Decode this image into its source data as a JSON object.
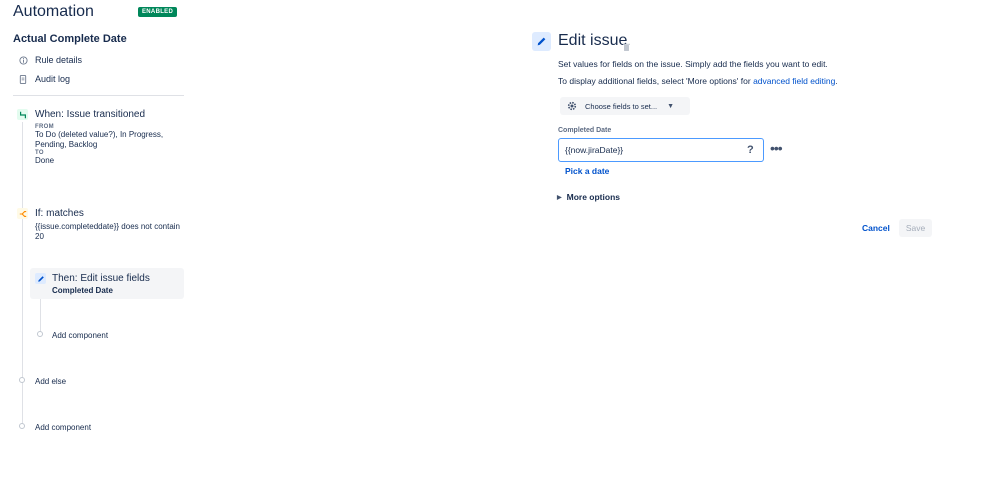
{
  "app": {
    "title": "Automation",
    "status_badge": "ENABLED",
    "rule_name": "Actual Complete Date"
  },
  "nav": [
    {
      "label": "Rule details",
      "icon": "info-icon"
    },
    {
      "label": "Audit log",
      "icon": "document-icon"
    }
  ],
  "trigger": {
    "title": "When: Issue transitioned",
    "from_label": "FROM",
    "from_value": "To Do (deleted value?), In Progress, Pending, Backlog",
    "to_label": "TO",
    "to_value": "Done"
  },
  "condition": {
    "title": "If: matches",
    "detail": "{{issue.completeddate}} does not contain 20"
  },
  "action": {
    "title": "Then: Edit issue fields",
    "detail": "Completed Date"
  },
  "add_links": {
    "inner_add_component": "Add component",
    "add_else": "Add else",
    "outer_add_component": "Add component"
  },
  "editor": {
    "title": "Edit issue",
    "desc_line1": "Set values for fields on the issue. Simply add the fields you want to edit.",
    "desc_line2_prefix": "To display additional fields, select 'More options' for ",
    "desc_line2_link": "advanced field editing",
    "desc_line2_suffix": ".",
    "choose_fields_label": "Choose fields to set...",
    "field_label": "Completed Date",
    "field_value": "{{now.jiraDate}}",
    "pick_date": "Pick a date",
    "more_options": "More options",
    "cancel": "Cancel",
    "save": "Save"
  },
  "colors": {
    "badge": "#00875a",
    "link": "#0052cc",
    "input_focus": "#4c9aff"
  }
}
